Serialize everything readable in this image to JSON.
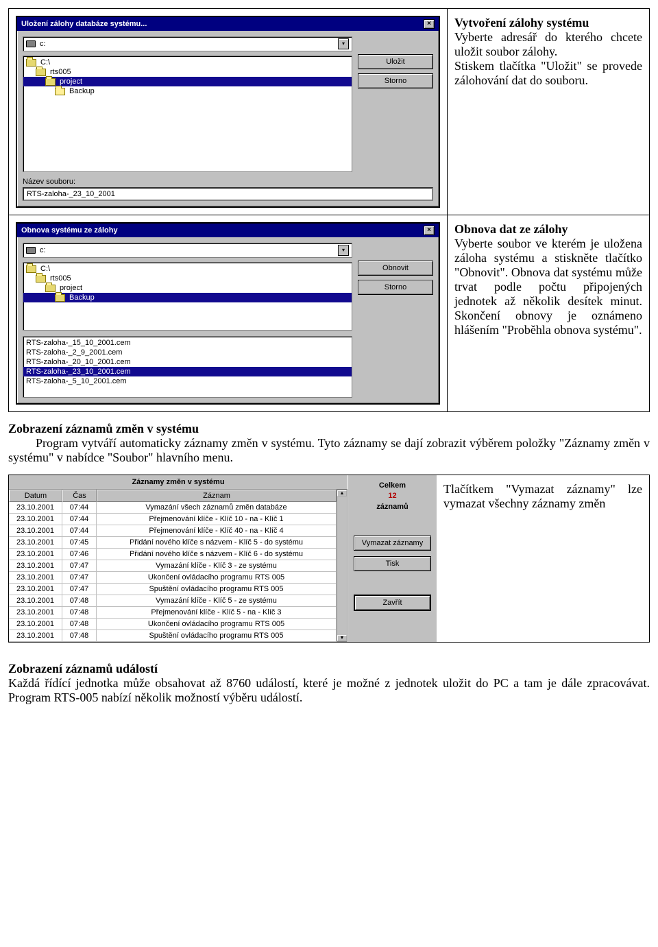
{
  "row1": {
    "dialog": {
      "title": "Uložení zálohy databáze systému...",
      "drive": "c:",
      "folders": [
        {
          "label": "C:\\",
          "indent": 0,
          "open": true,
          "sel": false
        },
        {
          "label": "rts005",
          "indent": 1,
          "open": true,
          "sel": false
        },
        {
          "label": "project",
          "indent": 2,
          "open": true,
          "sel": true
        },
        {
          "label": "Backup",
          "indent": 3,
          "open": false,
          "sel": false
        }
      ],
      "btn_save": "Uložit",
      "btn_cancel": "Storno",
      "field_label": "Název souboru:",
      "field_value": "RTS-zaloha-_23_10_2001"
    },
    "text": {
      "title": "Vytvoření zálohy systému",
      "body": "Vyberte adresář do kterého chcete uložit soubor zálohy.\nStiskem tlačítka \"Uložit\" se provede zálohování dat do souboru."
    }
  },
  "row2": {
    "dialog": {
      "title": "Obnova systému ze zálohy",
      "drive": "c:",
      "folders": [
        {
          "label": "C:\\",
          "indent": 0,
          "open": true,
          "sel": false
        },
        {
          "label": "rts005",
          "indent": 1,
          "open": true,
          "sel": false
        },
        {
          "label": "project",
          "indent": 2,
          "open": true,
          "sel": false
        },
        {
          "label": "Backup",
          "indent": 3,
          "open": true,
          "sel": true
        }
      ],
      "files": [
        {
          "label": "RTS-zaloha-_15_10_2001.cem",
          "sel": false
        },
        {
          "label": "RTS-zaloha-_2_9_2001.cem",
          "sel": false
        },
        {
          "label": "RTS-zaloha-_20_10_2001.cem",
          "sel": false
        },
        {
          "label": "RTS-zaloha-_23_10_2001.cem",
          "sel": true
        },
        {
          "label": "RTS-zaloha-_5_10_2001.cem",
          "sel": false
        }
      ],
      "btn_restore": "Obnovit",
      "btn_cancel": "Storno"
    },
    "text": {
      "title": "Obnova dat ze zálohy",
      "body": "Vyberte soubor ve kterém je uložena záloha systému a stiskněte tlačítko \"Obnovit\". Obnova dat systému může trvat podle počtu připojených jednotek až několik desítek minut. Skončení obnovy je oznámeno hlášením \"Proběhla obnova systému\"."
    }
  },
  "section3": {
    "title": "Zobrazení záznamů změn v systému",
    "body": "Program vytváří automaticky záznamy změn v systému. Tyto záznamy se dají zobrazit výběrem položky \"Záznamy změn v systému\" v nabídce \"Soubor\" hlavního menu.",
    "right_text": "Tlačítkem \"Vymazat záznamy\" lze vymazat všechny záznamy změn",
    "dialog": {
      "title": "Záznamy změn v systému",
      "headers": {
        "date": "Datum",
        "time": "Čas",
        "rec": "Záznam"
      },
      "rows": [
        {
          "d": "23.10.2001",
          "t": "07:44",
          "r": "Vymazání všech záznamů změn databáze"
        },
        {
          "d": "23.10.2001",
          "t": "07:44",
          "r": "Přejmenování klíče - Klíč 10 - na - Klíč 1"
        },
        {
          "d": "23.10.2001",
          "t": "07:44",
          "r": "Přejmenování klíče - Klíč 40 - na - Klíč 4"
        },
        {
          "d": "23.10.2001",
          "t": "07:45",
          "r": "Přidání nového klíče s názvem - Klíč 5 - do systému"
        },
        {
          "d": "23.10.2001",
          "t": "07:46",
          "r": "Přidání nového klíče s názvem - Klíč 6 - do systému"
        },
        {
          "d": "23.10.2001",
          "t": "07:47",
          "r": "Vymazání klíče - Klíč 3 - ze systému"
        },
        {
          "d": "23.10.2001",
          "t": "07:47",
          "r": "Ukončení ovládacího programu RTS 005"
        },
        {
          "d": "23.10.2001",
          "t": "07:47",
          "r": "Spuštění ovládacího programu RTS 005"
        },
        {
          "d": "23.10.2001",
          "t": "07:48",
          "r": "Vymazání klíče - Klíč 5 - ze systému"
        },
        {
          "d": "23.10.2001",
          "t": "07:48",
          "r": "Přejmenování klíče - Klíč 5 - na - Klíč 3"
        },
        {
          "d": "23.10.2001",
          "t": "07:48",
          "r": "Ukončení ovládacího programu RTS 005"
        },
        {
          "d": "23.10.2001",
          "t": "07:48",
          "r": "Spuštění ovládacího programu RTS 005"
        }
      ],
      "count_label1": "Celkem",
      "count_value": "12",
      "count_label2": "záznamů",
      "btn_clear": "Vymazat záznamy",
      "btn_print": "Tisk",
      "btn_close": "Zavřít"
    }
  },
  "section4": {
    "title": "Zobrazení záznamů událostí",
    "body": "Každá řídící jednotka může obsahovat až 8760 událostí, které je možné z jednotek uložit do PC a tam je dále zpracovávat. Program RTS-005 nabízí několik možností výběru událostí."
  }
}
